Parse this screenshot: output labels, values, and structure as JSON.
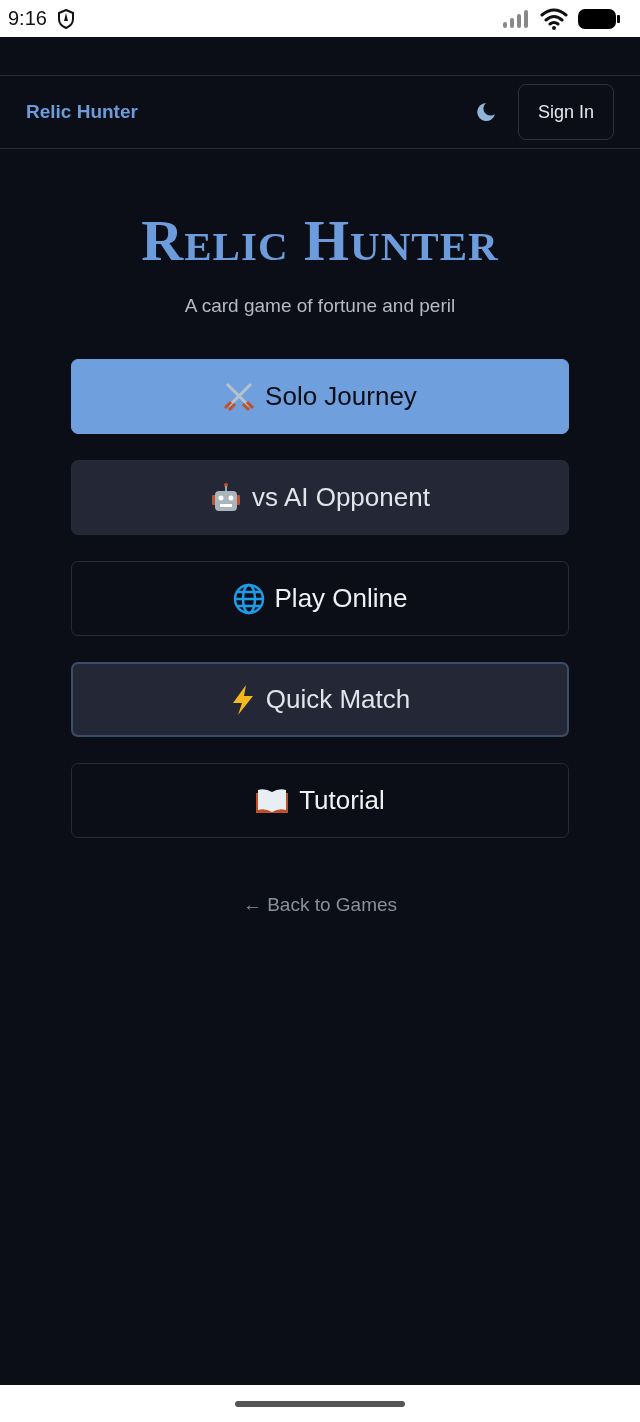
{
  "status_bar": {
    "time": "9:16"
  },
  "navbar": {
    "brand": "Relic Hunter",
    "action": "Sign In"
  },
  "hero": {
    "title": "Relic Hunter",
    "subtitle": "A card game of fortune and peril"
  },
  "menu": [
    {
      "kind": "primary",
      "label": "Solo Journey",
      "focused": false
    },
    {
      "kind": "secondary",
      "label": "vs AI Opponent",
      "focused": false
    },
    {
      "kind": "outline",
      "label": "Play Online",
      "focused": false
    },
    {
      "kind": "secondary",
      "label": "Quick Match",
      "focused": true
    },
    {
      "kind": "outline",
      "label": "Tutorial",
      "focused": false
    }
  ],
  "back_link": {
    "arrow": "←",
    "label": "Back to Games"
  }
}
